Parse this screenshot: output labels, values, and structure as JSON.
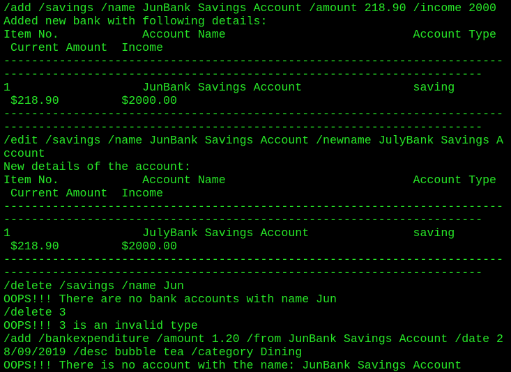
{
  "terminal": {
    "text_color": "#27e627",
    "background": "#000000",
    "lines": [
      "/add /savings /name JunBank Savings Account /amount 218.90 /income 2000",
      "Added new bank with following details:",
      "Item No.            Account Name                           Account Type",
      " Current Amount  Income",
      "------------------------------------------------------------------------",
      "---------------------------------------------------------------------",
      "1                   JunBank Savings Account                saving",
      " $218.90         $2000.00",
      "------------------------------------------------------------------------",
      "---------------------------------------------------------------------",
      "/edit /savings /name JunBank Savings Account /newname JulyBank Savings A",
      "ccount",
      "New details of the account:",
      "Item No.            Account Name                           Account Type",
      " Current Amount  Income",
      "------------------------------------------------------------------------",
      "---------------------------------------------------------------------",
      "1                   JulyBank Savings Account               saving",
      " $218.90         $2000.00",
      "------------------------------------------------------------------------",
      "---------------------------------------------------------------------",
      "/delete /savings /name Jun",
      "OOPS!!! There are no bank accounts with name Jun",
      "/delete 3",
      "OOPS!!! 3 is an invalid type",
      "/add /bankexpenditure /amount 1.20 /from JunBank Savings Account /date 2",
      "8/09/2019 /desc bubble tea /category Dining",
      "OOPS!!! There is no account with the name: JunBank Savings Account"
    ]
  }
}
